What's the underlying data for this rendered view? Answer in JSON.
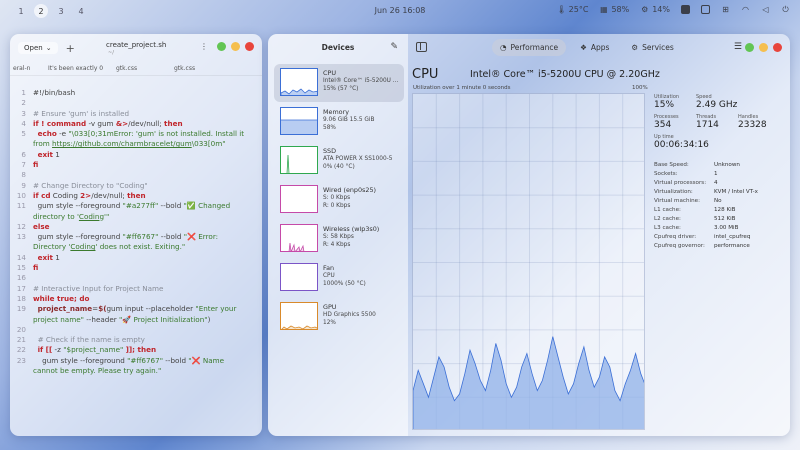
{
  "topbar": {
    "workspaces": [
      "1",
      "2",
      "3",
      "4"
    ],
    "active_workspace": "2",
    "clock": "Jun 26  16:08",
    "temperature": "25°C",
    "memory": "58%",
    "cpu": "14%"
  },
  "editor": {
    "open_label": "Open",
    "title": "create_project.sh",
    "path": "~/",
    "tabs": [
      "eral-n",
      "It's been exactly 0",
      "gtk.css",
      "gtk.css"
    ],
    "lines": [
      {
        "n": "1",
        "html": "#!/bin/bash"
      },
      {
        "n": "2",
        "html": ""
      },
      {
        "n": "3",
        "html": "<span class='cm'># Ensure 'gum' is installed</span>"
      },
      {
        "n": "4",
        "html": "<span class='kw'>if ! command</span> -v gum <span class='kw'>&amp;&gt;</span>/dev/null; <span class='kw'>then</span>"
      },
      {
        "n": "5",
        "html": "&nbsp;&nbsp;<span class='kw'>echo</span> -e <span class='st'>\"\\033[0;31mError: 'gum' is not installed. Install it from <span class='ul'>https://github.com/charmbracelet/gum</span>\\033[0m\"</span>"
      },
      {
        "n": "6",
        "html": "&nbsp;&nbsp;<span class='kw'>exit</span> 1"
      },
      {
        "n": "7",
        "html": "<span class='kw'>fi</span>"
      },
      {
        "n": "8",
        "html": ""
      },
      {
        "n": "9",
        "html": "<span class='cm'># Change Directory to \"Coding\"</span>"
      },
      {
        "n": "10",
        "html": "<span class='kw'>if cd</span> Coding <span class='kw'>2&gt;</span>/dev/null; <span class='kw'>then</span>"
      },
      {
        "n": "11",
        "html": "&nbsp;&nbsp;gum style --foreground <span class='st'>\"#a277ff\"</span> --bold <span class='st'>\"✅ Changed directory to '<span class='ul'>Coding</span>'\"</span>"
      },
      {
        "n": "12",
        "html": "<span class='kw'>else</span>"
      },
      {
        "n": "13",
        "html": "&nbsp;&nbsp;gum style --foreground <span class='st'>\"#ff6767\"</span> --bold <span class='st'>\"❌ Error: Directory '<span class='ul'>Coding</span>' does not exist. Exiting.\"</span>"
      },
      {
        "n": "14",
        "html": "&nbsp;&nbsp;<span class='kw'>exit</span> 1"
      },
      {
        "n": "15",
        "html": "<span class='kw'>fi</span>"
      },
      {
        "n": "16",
        "html": ""
      },
      {
        "n": "17",
        "html": "<span class='cm'># Interactive Input for Project Name</span>"
      },
      {
        "n": "18",
        "html": "<span class='kw'>while true; do</span>"
      },
      {
        "n": "19",
        "html": "&nbsp;&nbsp;<span class='var'>project_name</span>=<span class='var'>$(</span>gum input --placeholder <span class='st'>\"Enter your project name\"</span> --header <span class='st'>\"🚀 Project Initialization\"</span>)"
      },
      {
        "n": "20",
        "html": ""
      },
      {
        "n": "21",
        "html": "&nbsp;&nbsp;<span class='cm'># Check if the name is empty</span>"
      },
      {
        "n": "22",
        "html": "&nbsp;&nbsp;<span class='kw'>if [[</span> -z <span class='st'>\"$project_name\"</span> <span class='kw'>]]; then</span>"
      },
      {
        "n": "23",
        "html": "&nbsp;&nbsp;&nbsp;&nbsp;gum style --foreground <span class='st'>\"#ff6767\"</span> --bold <span class='st'>\"❌ Name cannot be empty. Please try again.\"</span>"
      }
    ]
  },
  "monitor": {
    "sidebar_title": "Devices",
    "tabs": [
      {
        "label": "Performance",
        "icon": "gauge-icon"
      },
      {
        "label": "Apps",
        "icon": "apps-icon"
      },
      {
        "label": "Services",
        "icon": "services-icon"
      }
    ],
    "devices": [
      {
        "name": "CPU",
        "l1": "Intel® Core™ i5-5200U ...",
        "l2": "15% (57 °C)",
        "color": "#3b6fd6",
        "fill": "#bcd0f3"
      },
      {
        "name": "Memory",
        "l1": "9.06 GiB 15.5 GiB",
        "l2": "58%",
        "color": "#3b6fd6",
        "fill": "#b8cdf2"
      },
      {
        "name": "SSD",
        "l1": "ATA POWER X SS1000-5",
        "l2": "0% (40 °C)",
        "color": "#2fa84f",
        "fill": "#d5efdb"
      },
      {
        "name": "Wired (enp0s25)",
        "l1": "S: 0 Kbps",
        "l2": "R: 0 Kbps",
        "color": "#c54aa8",
        "fill": "#f3d7ec"
      },
      {
        "name": "Wireless (wlp3s0)",
        "l1": "S: 58 Kbps",
        "l2": "R: 4 Kbps",
        "color": "#c54aa8",
        "fill": "#f3d7ec"
      },
      {
        "name": "Fan",
        "l1": "CPU",
        "l2": "1000% (50 °C)",
        "color": "#7b55c7",
        "fill": "#e5dbf5"
      },
      {
        "name": "GPU",
        "l1": "HD Graphics 5500",
        "l2": "12%",
        "color": "#d98a2b",
        "fill": "#f6e6d0"
      }
    ],
    "cpu_title": "CPU",
    "cpu_model": "Intel® Core™ i5-5200U CPU @ 2.20GHz",
    "util_label": "Utilization over 1 minute 0 seconds",
    "util_max": "100%",
    "stats": {
      "utilization_label": "Utilization",
      "utilization": "15%",
      "speed_label": "Speed",
      "speed": "2.49 GHz",
      "processes_label": "Processes",
      "processes": "354",
      "threads_label": "Threads",
      "threads": "1714",
      "handles_label": "Handles",
      "handles": "23328",
      "uptime_label": "Up time",
      "uptime": "00:06:34:16"
    },
    "details": [
      {
        "k": "Base Speed:",
        "v": "Unknown"
      },
      {
        "k": "Sockets:",
        "v": "1"
      },
      {
        "k": "Virtual processors:",
        "v": "4"
      },
      {
        "k": "Virtualization:",
        "v": "KVM / Intel VT-x"
      },
      {
        "k": "Virtual machine:",
        "v": "No"
      },
      {
        "k": "L1 cache:",
        "v": "128 KiB"
      },
      {
        "k": "L2 cache:",
        "v": "512 KiB"
      },
      {
        "k": "L3 cache:",
        "v": "3.00 MiB"
      },
      {
        "k": "Cpufreq driver:",
        "v": "intel_cpufreq"
      },
      {
        "k": "Cpufreq governor:",
        "v": "performance"
      }
    ],
    "cpu_history": [
      12,
      18,
      14,
      10,
      16,
      22,
      19,
      13,
      9,
      11,
      17,
      24,
      20,
      15,
      12,
      18,
      26,
      21,
      14,
      10,
      13,
      19,
      23,
      17,
      12,
      15,
      21,
      28,
      22,
      16,
      11,
      14,
      20,
      25,
      18,
      13,
      16,
      22,
      19,
      12,
      9,
      14,
      18,
      23,
      17,
      13
    ]
  },
  "colors": {
    "close": "#e8453c",
    "maximize": "#f5bf4f",
    "minimize": "#62c554",
    "graph_line": "#3b6fd6",
    "graph_fill": "#8fb0e8"
  }
}
